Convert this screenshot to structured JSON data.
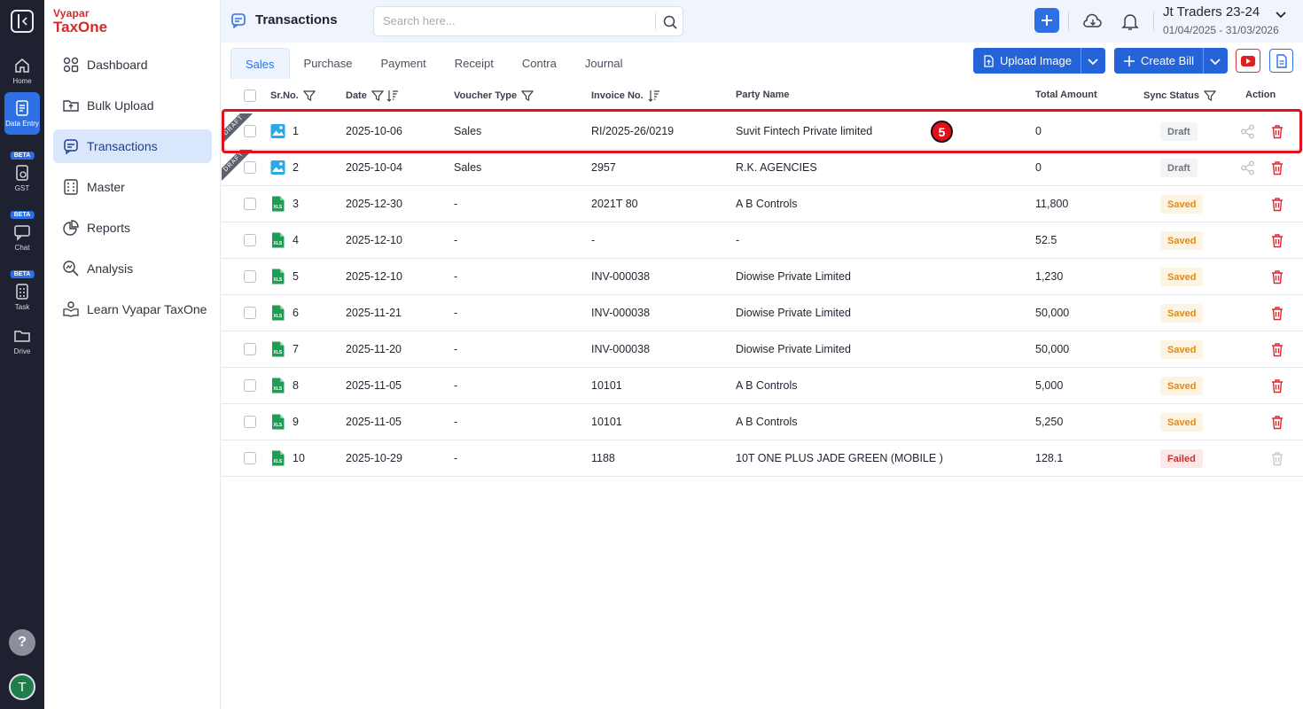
{
  "rail": {
    "items": [
      {
        "label": "Home"
      },
      {
        "label": "Data Entry"
      },
      {
        "label": "GST",
        "badge": "BETA"
      },
      {
        "label": "Chat",
        "badge": "BETA"
      },
      {
        "label": "Task",
        "badge": "BETA"
      },
      {
        "label": "Drive"
      }
    ],
    "help": "?",
    "avatar_initial": "T"
  },
  "brand": {
    "line1": "Vyapar",
    "line2": "TaxOne"
  },
  "nav": {
    "items": [
      {
        "label": "Dashboard",
        "icon": "grid-icon"
      },
      {
        "label": "Bulk Upload",
        "icon": "upload-folder-icon"
      },
      {
        "label": "Transactions",
        "icon": "transactions-icon",
        "active": true
      },
      {
        "label": "Master",
        "icon": "master-icon"
      },
      {
        "label": "Reports",
        "icon": "pie-chart-icon"
      },
      {
        "label": "Analysis",
        "icon": "analysis-icon"
      },
      {
        "label": "Learn Vyapar TaxOne",
        "icon": "learn-icon"
      }
    ]
  },
  "header": {
    "title": "Transactions",
    "search_placeholder": "Search here...",
    "company_name": "Jt Traders 23-24",
    "period": "01/04/2025 - 31/03/2026"
  },
  "tabs": [
    "Sales",
    "Purchase",
    "Payment",
    "Receipt",
    "Contra",
    "Journal"
  ],
  "actions": {
    "upload_image": "Upload Image",
    "create_bill": "Create Bill"
  },
  "table": {
    "columns": {
      "srno": "Sr.No.",
      "date": "Date",
      "voucher_type": "Voucher Type",
      "invoice_no": "Invoice No.",
      "party_name": "Party Name",
      "total_amount": "Total Amount",
      "sync_status": "Sync Status",
      "action": "Action"
    },
    "ribbon_text": "DRAFT",
    "rows": [
      {
        "sr": "1",
        "date": "2025-10-06",
        "voucher": "Sales",
        "invoice": "RI/2025-26/0219",
        "party": "Suvit Fintech Private limited",
        "amount": "0",
        "status": "Draft",
        "file": "image",
        "draft": true
      },
      {
        "sr": "2",
        "date": "2025-10-04",
        "voucher": "Sales",
        "invoice": "2957",
        "party": "R.K. AGENCIES",
        "amount": "0",
        "status": "Draft",
        "file": "image",
        "draft": true
      },
      {
        "sr": "3",
        "date": "2025-12-30",
        "voucher": "-",
        "invoice": "2021T 80",
        "party": "A B Controls",
        "amount": "11,800",
        "status": "Saved",
        "file": "xls"
      },
      {
        "sr": "4",
        "date": "2025-12-10",
        "voucher": "-",
        "invoice": "-",
        "party": "-",
        "amount": "52.5",
        "status": "Saved",
        "file": "xls"
      },
      {
        "sr": "5",
        "date": "2025-12-10",
        "voucher": "-",
        "invoice": "INV-000038",
        "party": "Diowise Private Limited",
        "amount": "1,230",
        "status": "Saved",
        "file": "xls"
      },
      {
        "sr": "6",
        "date": "2025-11-21",
        "voucher": "-",
        "invoice": "INV-000038",
        "party": "Diowise Private Limited",
        "amount": "50,000",
        "status": "Saved",
        "file": "xls"
      },
      {
        "sr": "7",
        "date": "2025-11-20",
        "voucher": "-",
        "invoice": "INV-000038",
        "party": "Diowise Private Limited",
        "amount": "50,000",
        "status": "Saved",
        "file": "xls"
      },
      {
        "sr": "8",
        "date": "2025-11-05",
        "voucher": "-",
        "invoice": "10101",
        "party": "A B Controls",
        "amount": "5,000",
        "status": "Saved",
        "file": "xls"
      },
      {
        "sr": "9",
        "date": "2025-11-05",
        "voucher": "-",
        "invoice": "10101",
        "party": "A B Controls",
        "amount": "5,250",
        "status": "Saved",
        "file": "xls"
      },
      {
        "sr": "10",
        "date": "2025-10-29",
        "voucher": "-",
        "invoice": "1188",
        "party": "10T ONE PLUS JADE GREEN (MOBILE )",
        "amount": "128.1",
        "status": "Failed",
        "file": "xls"
      }
    ]
  },
  "annotation": {
    "step": "5"
  },
  "colors": {
    "accent": "#2f6fe4",
    "highlight": "#e3101b",
    "saved": "#e08a14",
    "failed": "#d62a2a"
  }
}
